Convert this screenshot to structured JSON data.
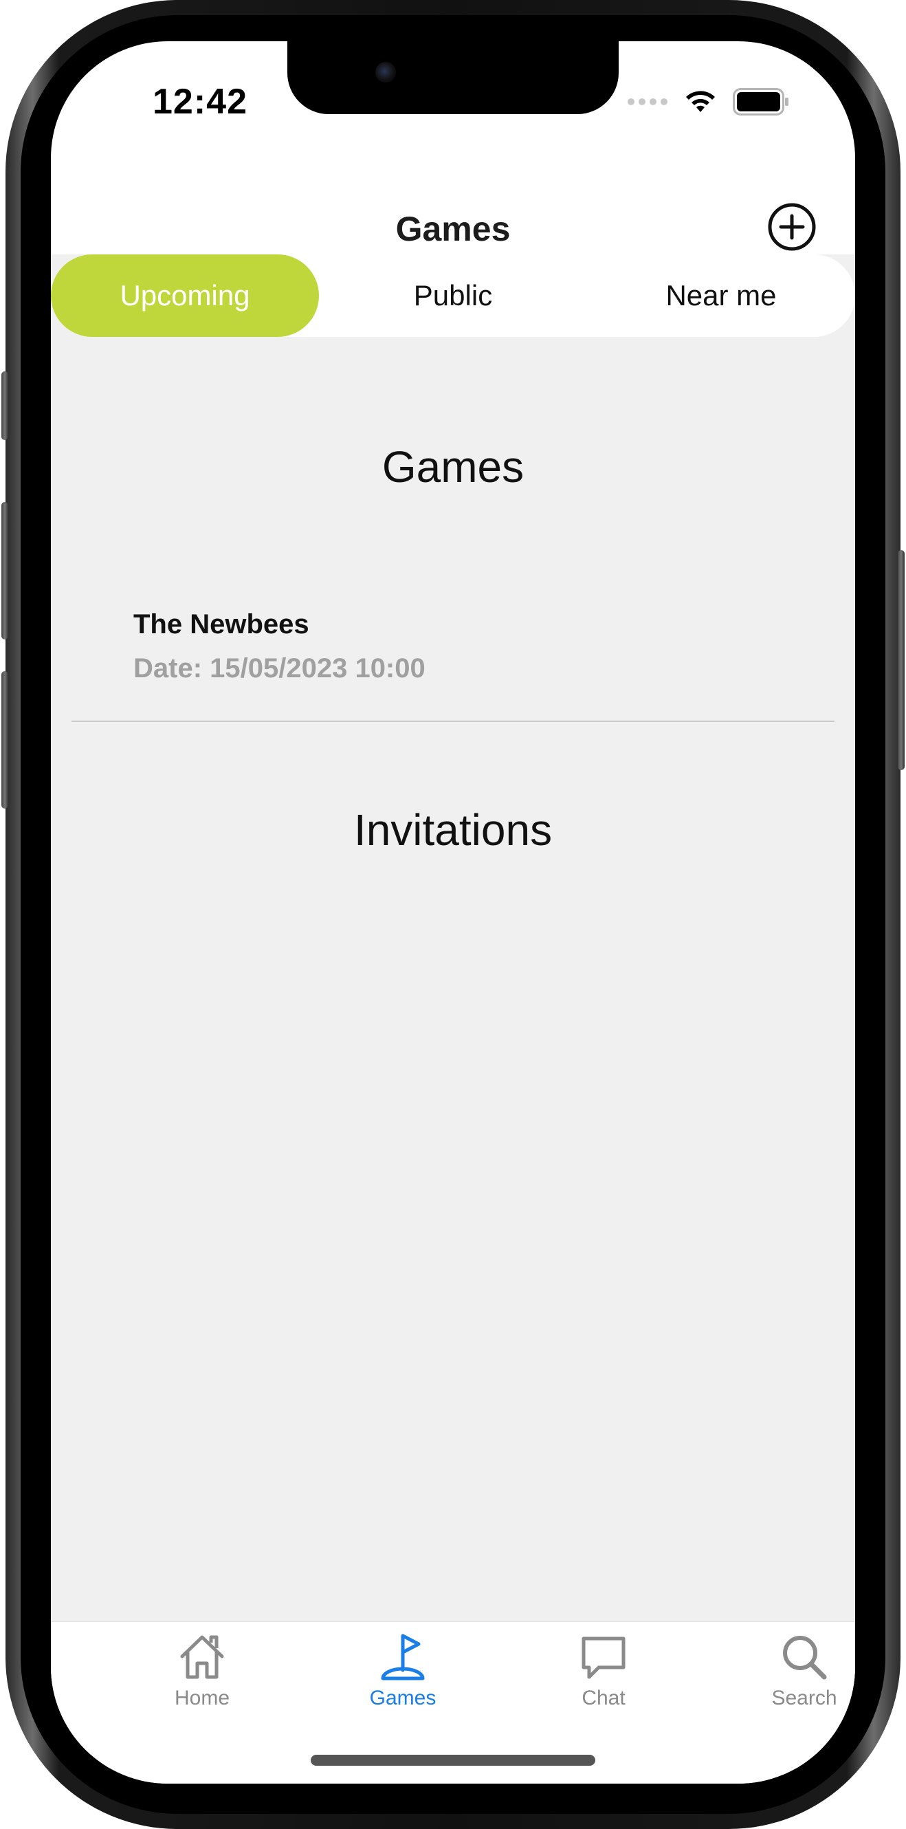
{
  "status_bar": {
    "time": "12:42"
  },
  "header": {
    "title": "Games",
    "add_icon": "plus-circle-icon"
  },
  "segments": {
    "items": [
      {
        "label": "Upcoming",
        "active": true
      },
      {
        "label": "Public",
        "active": false
      },
      {
        "label": "Near me",
        "active": false
      }
    ]
  },
  "sections": {
    "games_title": "Games",
    "invitations_title": "Invitations"
  },
  "games": [
    {
      "name": "The Newbees",
      "date": "Date: 15/05/2023 10:00"
    }
  ],
  "tab_bar": {
    "items": [
      {
        "label": "Home",
        "icon": "house-icon",
        "active": false
      },
      {
        "label": "Games",
        "icon": "golf-flag-icon",
        "active": true
      },
      {
        "label": "Chat",
        "icon": "chat-bubble-icon",
        "active": false
      },
      {
        "label": "Search",
        "icon": "magnifier-icon",
        "active": false
      }
    ]
  },
  "colors": {
    "accent": "#c0d73b",
    "tab_active": "#1a7ee8",
    "tab_inactive": "#8a8a8a",
    "background": "#f0f0f0",
    "subtitle_gray": "#a0a0a0"
  }
}
